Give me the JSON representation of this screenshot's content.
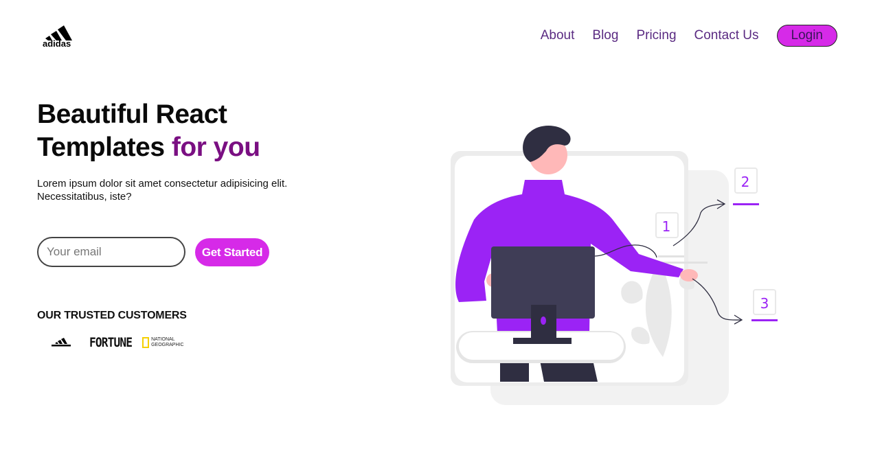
{
  "brand": {
    "name": "adidas",
    "logo_icon": "adidas-logo-icon"
  },
  "nav": {
    "items": [
      {
        "label": "About"
      },
      {
        "label": "Blog"
      },
      {
        "label": "Pricing"
      },
      {
        "label": "Contact Us"
      }
    ],
    "login_label": "Login"
  },
  "hero": {
    "title_line1": "Beautiful React",
    "title_line2": "Templates",
    "title_accent": "for you",
    "subtitle": "Lorem ipsum dolor sit amet consectetur adipisicing elit. Necessitatibus, iste?",
    "email_placeholder": "Your email",
    "cta_label": "Get Started"
  },
  "trusted": {
    "title": "OUR TRUSTED CUSTOMERS",
    "logos": [
      "adidas",
      "FORTUNE",
      "NATIONAL GEOGRAPHIC"
    ]
  },
  "illustration": {
    "step_numbers": [
      "1",
      "2",
      "3"
    ]
  },
  "colors": {
    "accent": "#d62ae8",
    "title_accent": "#7a0f82",
    "nav_text": "#5a2a82",
    "figure_purple": "#9b23f5"
  }
}
